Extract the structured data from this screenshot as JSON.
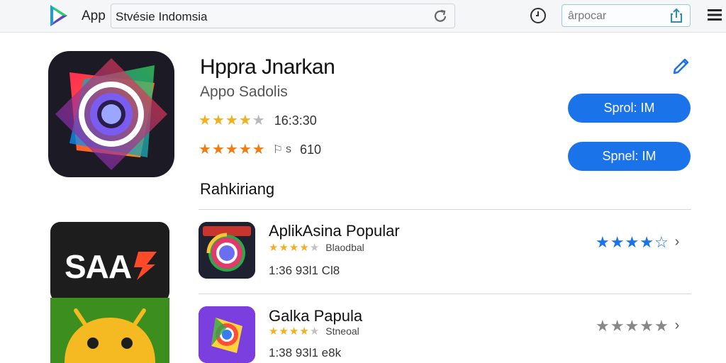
{
  "header": {
    "title_prefix": "App",
    "url_text": "Stvésie Indomsia",
    "search_placeholder": "ârpocar",
    "icons": [
      "play-store-logo-icon",
      "reload-icon",
      "clock-icon",
      "share-icon",
      "menu-icon"
    ]
  },
  "hero": {
    "title": "Hppra Jnarkan",
    "developer": "Appo Sadolis",
    "rating1": {
      "stars_filled": 4,
      "stars_total": 5,
      "text": "16:3:30"
    },
    "rating2": {
      "stars_filled": 5,
      "stars_total": 5,
      "icon": "⚐",
      "extra_text": "s",
      "text": "610"
    },
    "button1_label": "Sprol: IM",
    "button2_label": "Spnel: IM",
    "colors": {
      "button": "#1a73e8",
      "star_gold": "#f2b01e",
      "star_orange": "#ee7d14"
    }
  },
  "section": {
    "title": "Rahkiriang"
  },
  "promos": [
    {
      "text": "SAA"
    },
    {
      "text": ""
    }
  ],
  "list": [
    {
      "title": "AplikAsina Popular",
      "stars_filled": 4,
      "sub_text": "Blaodbal",
      "meta": "1:36 93l1  Cl8",
      "right_stars": 4,
      "right_star_color": "#1a73e8"
    },
    {
      "title": "Galka  Papula",
      "stars_filled": 4,
      "sub_text": "Stneoal",
      "meta": "1:38 93l1  e8k",
      "right_stars": 5,
      "right_star_color": "#888888"
    }
  ]
}
